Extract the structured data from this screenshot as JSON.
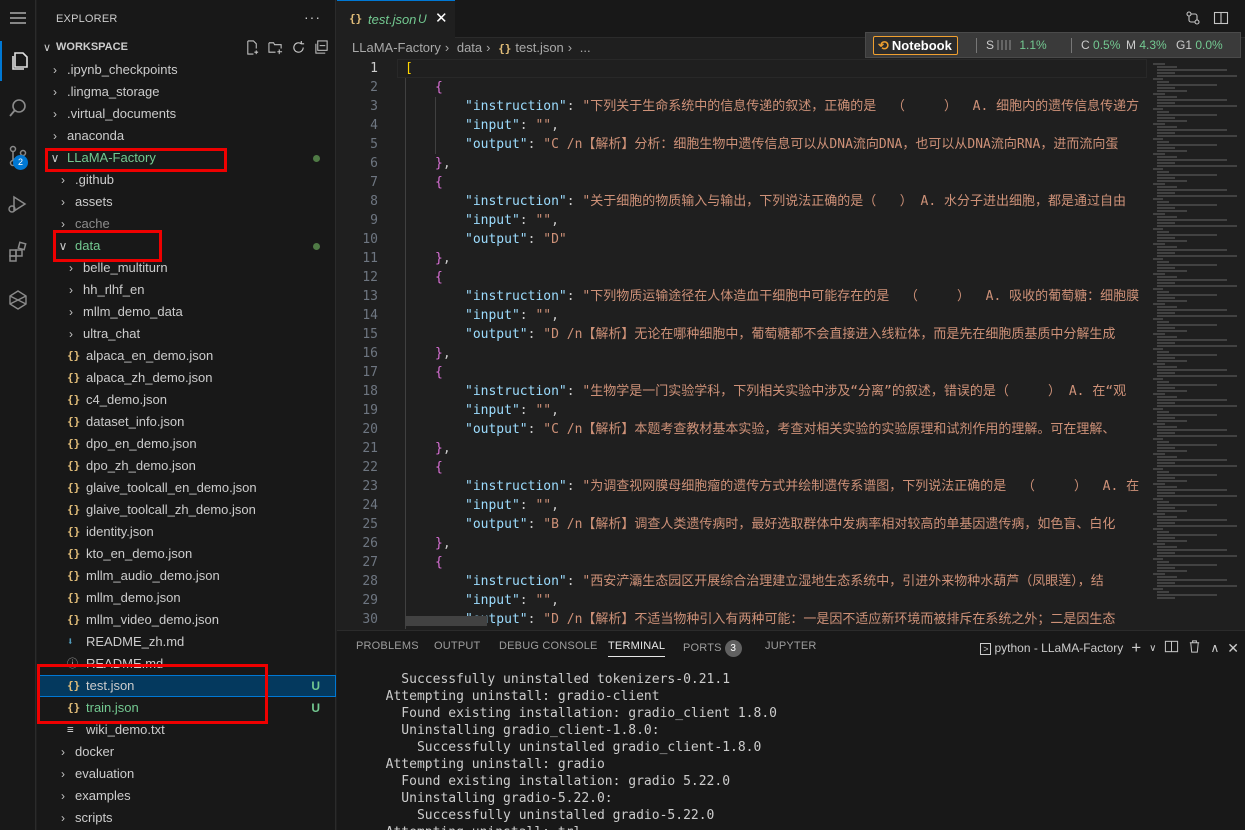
{
  "activity_bar": {
    "items": [
      {
        "name": "explorer-icon"
      },
      {
        "name": "search-icon"
      },
      {
        "name": "source-control-icon",
        "badge": "2"
      },
      {
        "name": "run-debug-icon"
      },
      {
        "name": "extensions-icon"
      },
      {
        "name": "remote-icon"
      }
    ]
  },
  "sidebar": {
    "title": "EXPLORER",
    "more": "···",
    "workspace": "WORKSPACE",
    "tree": [
      {
        "label": ".ipynb_checkpoints",
        "type": "folder",
        "depth": 0
      },
      {
        "label": ".lingma_storage",
        "type": "folder",
        "depth": 0
      },
      {
        "label": ".virtual_documents",
        "type": "folder",
        "depth": 0
      },
      {
        "label": "anaconda",
        "type": "folder",
        "depth": 0
      },
      {
        "label": "LLaMA-Factory",
        "type": "folder-open",
        "depth": 0,
        "color": "green",
        "dot": true
      },
      {
        "label": ".github",
        "type": "folder",
        "depth": 1
      },
      {
        "label": "assets",
        "type": "folder",
        "depth": 1
      },
      {
        "label": "cache",
        "type": "folder",
        "depth": 1,
        "color": "dim"
      },
      {
        "label": "data",
        "type": "folder-open",
        "depth": 1,
        "color": "green",
        "dot": true
      },
      {
        "label": "belle_multiturn",
        "type": "folder",
        "depth": 2
      },
      {
        "label": "hh_rlhf_en",
        "type": "folder",
        "depth": 2
      },
      {
        "label": "mllm_demo_data",
        "type": "folder",
        "depth": 2
      },
      {
        "label": "ultra_chat",
        "type": "folder",
        "depth": 2
      },
      {
        "label": "alpaca_en_demo.json",
        "type": "json",
        "depth": 2
      },
      {
        "label": "alpaca_zh_demo.json",
        "type": "json",
        "depth": 2
      },
      {
        "label": "c4_demo.json",
        "type": "json",
        "depth": 2
      },
      {
        "label": "dataset_info.json",
        "type": "json",
        "depth": 2
      },
      {
        "label": "dpo_en_demo.json",
        "type": "json",
        "depth": 2
      },
      {
        "label": "dpo_zh_demo.json",
        "type": "json",
        "depth": 2
      },
      {
        "label": "glaive_toolcall_en_demo.json",
        "type": "json",
        "depth": 2
      },
      {
        "label": "glaive_toolcall_zh_demo.json",
        "type": "json",
        "depth": 2
      },
      {
        "label": "identity.json",
        "type": "json",
        "depth": 2
      },
      {
        "label": "kto_en_demo.json",
        "type": "json",
        "depth": 2
      },
      {
        "label": "mllm_audio_demo.json",
        "type": "json",
        "depth": 2
      },
      {
        "label": "mllm_demo.json",
        "type": "json",
        "depth": 2
      },
      {
        "label": "mllm_video_demo.json",
        "type": "json",
        "depth": 2
      },
      {
        "label": "README_zh.md",
        "type": "md",
        "depth": 2
      },
      {
        "label": "README.md",
        "type": "info",
        "depth": 2
      },
      {
        "label": "test.json",
        "type": "json",
        "depth": 2,
        "status": "U",
        "selected": true
      },
      {
        "label": "train.json",
        "type": "json",
        "depth": 2,
        "status": "U",
        "color": "green"
      },
      {
        "label": "wiki_demo.txt",
        "type": "txt",
        "depth": 2
      },
      {
        "label": "docker",
        "type": "folder",
        "depth": 1
      },
      {
        "label": "evaluation",
        "type": "folder",
        "depth": 1
      },
      {
        "label": "examples",
        "type": "folder",
        "depth": 1
      },
      {
        "label": "scripts",
        "type": "folder",
        "depth": 1
      }
    ]
  },
  "editor": {
    "tab": {
      "icon": "{}",
      "name": "test.json",
      "status": "U",
      "close": "✕"
    },
    "breadcrumb": [
      "LLaMA-Factory",
      "data",
      "test.json",
      "..."
    ],
    "notebook": {
      "label": "Notebook",
      "s_label": "S",
      "s_value": "1.1%",
      "c_label": "C",
      "c_value": "0.5%",
      "m_label": "M",
      "m_value": "4.3%",
      "g_label": "G1",
      "g_value": "0.0%"
    },
    "lines": [
      {
        "n": "1",
        "indent": 0,
        "parts": [
          [
            "br1",
            "["
          ]
        ]
      },
      {
        "n": "2",
        "indent": 1,
        "parts": [
          [
            "br2",
            "{"
          ]
        ]
      },
      {
        "n": "3",
        "indent": 2,
        "parts": [
          [
            "key",
            "\"instruction\""
          ],
          [
            "pun",
            ": "
          ],
          [
            "str",
            "\"下列关于生命系统中的信息传递的叙述，正确的是  （     ）  A. 细胞内的遗传信息传递方"
          ]
        ]
      },
      {
        "n": "4",
        "indent": 2,
        "parts": [
          [
            "key",
            "\"input\""
          ],
          [
            "pun",
            ": "
          ],
          [
            "str",
            "\"\""
          ],
          [
            "pun",
            ","
          ]
        ]
      },
      {
        "n": "5",
        "indent": 2,
        "parts": [
          [
            "key",
            "\"output\""
          ],
          [
            "pun",
            ": "
          ],
          [
            "str",
            "\"C /n【解析】分析：细胞生物中遗传信息可以从DNA流向DNA，也可以从DNA流向RNA，进而流向蛋"
          ]
        ]
      },
      {
        "n": "6",
        "indent": 1,
        "parts": [
          [
            "br2",
            "}"
          ],
          [
            "pun",
            ","
          ]
        ]
      },
      {
        "n": "7",
        "indent": 1,
        "parts": [
          [
            "br2",
            "{"
          ]
        ]
      },
      {
        "n": "8",
        "indent": 2,
        "parts": [
          [
            "key",
            "\"instruction\""
          ],
          [
            "pun",
            ": "
          ],
          [
            "str",
            "\"关于细胞的物质输入与输出，下列说法正确的是（   ） A. 水分子进出细胞，都是通过自由"
          ]
        ]
      },
      {
        "n": "9",
        "indent": 2,
        "parts": [
          [
            "key",
            "\"input\""
          ],
          [
            "pun",
            ": "
          ],
          [
            "str",
            "\"\""
          ],
          [
            "pun",
            ","
          ]
        ]
      },
      {
        "n": "10",
        "indent": 2,
        "parts": [
          [
            "key",
            "\"output\""
          ],
          [
            "pun",
            ": "
          ],
          [
            "str",
            "\"D\""
          ]
        ]
      },
      {
        "n": "11",
        "indent": 1,
        "parts": [
          [
            "br2",
            "}"
          ],
          [
            "pun",
            ","
          ]
        ]
      },
      {
        "n": "12",
        "indent": 1,
        "parts": [
          [
            "br2",
            "{"
          ]
        ]
      },
      {
        "n": "13",
        "indent": 2,
        "parts": [
          [
            "key",
            "\"instruction\""
          ],
          [
            "pun",
            ": "
          ],
          [
            "str",
            "\"下列物质运输途径在人体造血干细胞中可能存在的是  （     ）  A. 吸收的葡萄糖：细胞膜"
          ]
        ]
      },
      {
        "n": "14",
        "indent": 2,
        "parts": [
          [
            "key",
            "\"input\""
          ],
          [
            "pun",
            ": "
          ],
          [
            "str",
            "\"\""
          ],
          [
            "pun",
            ","
          ]
        ]
      },
      {
        "n": "15",
        "indent": 2,
        "parts": [
          [
            "key",
            "\"output\""
          ],
          [
            "pun",
            ": "
          ],
          [
            "str",
            "\"D /n【解析】无论在哪种细胞中，葡萄糖都不会直接进入线粒体，而是先在细胞质基质中分解生成"
          ]
        ]
      },
      {
        "n": "16",
        "indent": 1,
        "parts": [
          [
            "br2",
            "}"
          ],
          [
            "pun",
            ","
          ]
        ]
      },
      {
        "n": "17",
        "indent": 1,
        "parts": [
          [
            "br2",
            "{"
          ]
        ]
      },
      {
        "n": "18",
        "indent": 2,
        "parts": [
          [
            "key",
            "\"instruction\""
          ],
          [
            "pun",
            ": "
          ],
          [
            "str",
            "\"生物学是一门实验学科，下列相关实验中涉及“分离”的叙述，错误的是（     ） A. 在“观"
          ]
        ]
      },
      {
        "n": "19",
        "indent": 2,
        "parts": [
          [
            "key",
            "\"input\""
          ],
          [
            "pun",
            ": "
          ],
          [
            "str",
            "\"\""
          ],
          [
            "pun",
            ","
          ]
        ]
      },
      {
        "n": "20",
        "indent": 2,
        "parts": [
          [
            "key",
            "\"output\""
          ],
          [
            "pun",
            ": "
          ],
          [
            "str",
            "\"C /n【解析】本题考查教材基本实验，考查对相关实验的实验原理和试剂作用的理解。可在理解、"
          ]
        ]
      },
      {
        "n": "21",
        "indent": 1,
        "parts": [
          [
            "br2",
            "}"
          ],
          [
            "pun",
            ","
          ]
        ]
      },
      {
        "n": "22",
        "indent": 1,
        "parts": [
          [
            "br2",
            "{"
          ]
        ]
      },
      {
        "n": "23",
        "indent": 2,
        "parts": [
          [
            "key",
            "\"instruction\""
          ],
          [
            "pun",
            ": "
          ],
          [
            "str",
            "\"为调查视网膜母细胞瘤的遗传方式并绘制遗传系谱图，下列说法正确的是  （     ）  A. 在"
          ]
        ]
      },
      {
        "n": "24",
        "indent": 2,
        "parts": [
          [
            "key",
            "\"input\""
          ],
          [
            "pun",
            ": "
          ],
          [
            "str",
            "\"\""
          ],
          [
            "pun",
            ","
          ]
        ]
      },
      {
        "n": "25",
        "indent": 2,
        "parts": [
          [
            "key",
            "\"output\""
          ],
          [
            "pun",
            ": "
          ],
          [
            "str",
            "\"B /n【解析】调查人类遗传病时，最好选取群体中发病率相对较高的单基因遗传病，如色盲、白化"
          ]
        ]
      },
      {
        "n": "26",
        "indent": 1,
        "parts": [
          [
            "br2",
            "}"
          ],
          [
            "pun",
            ","
          ]
        ]
      },
      {
        "n": "27",
        "indent": 1,
        "parts": [
          [
            "br2",
            "{"
          ]
        ]
      },
      {
        "n": "28",
        "indent": 2,
        "parts": [
          [
            "key",
            "\"instruction\""
          ],
          [
            "pun",
            ": "
          ],
          [
            "str",
            "\"西安浐灞生态园区开展综合治理建立湿地生态系统中，引进外来物种水葫芦（凤眼莲），结"
          ]
        ]
      },
      {
        "n": "29",
        "indent": 2,
        "parts": [
          [
            "key",
            "\"input\""
          ],
          [
            "pun",
            ": "
          ],
          [
            "str",
            "\"\""
          ],
          [
            "pun",
            ","
          ]
        ]
      },
      {
        "n": "30",
        "indent": 2,
        "parts": [
          [
            "key",
            "\"output\""
          ],
          [
            "pun",
            ": "
          ],
          [
            "str",
            "\"D /n【解析】不适当物种引入有两种可能：一是因不适应新环境而被排斥在系统之外；二是因生态"
          ]
        ]
      }
    ]
  },
  "panel": {
    "tabs": [
      {
        "label": "PROBLEMS"
      },
      {
        "label": "OUTPUT"
      },
      {
        "label": "DEBUG CONSOLE"
      },
      {
        "label": "TERMINAL",
        "active": true
      },
      {
        "label": "PORTS",
        "badge": "3"
      },
      {
        "label": "JUPYTER"
      }
    ],
    "terminal_name": "python - LLaMA-Factory",
    "terminal_lines": [
      "    Successfully uninstalled tokenizers-0.21.1",
      "  Attempting uninstall: gradio-client",
      "    Found existing installation: gradio_client 1.8.0",
      "    Uninstalling gradio_client-1.8.0:",
      "      Successfully uninstalled gradio_client-1.8.0",
      "  Attempting uninstall: gradio",
      "    Found existing installation: gradio 5.22.0",
      "    Uninstalling gradio-5.22.0:",
      "      Successfully uninstalled gradio-5.22.0",
      "  Attempting uninstall: trl"
    ]
  }
}
